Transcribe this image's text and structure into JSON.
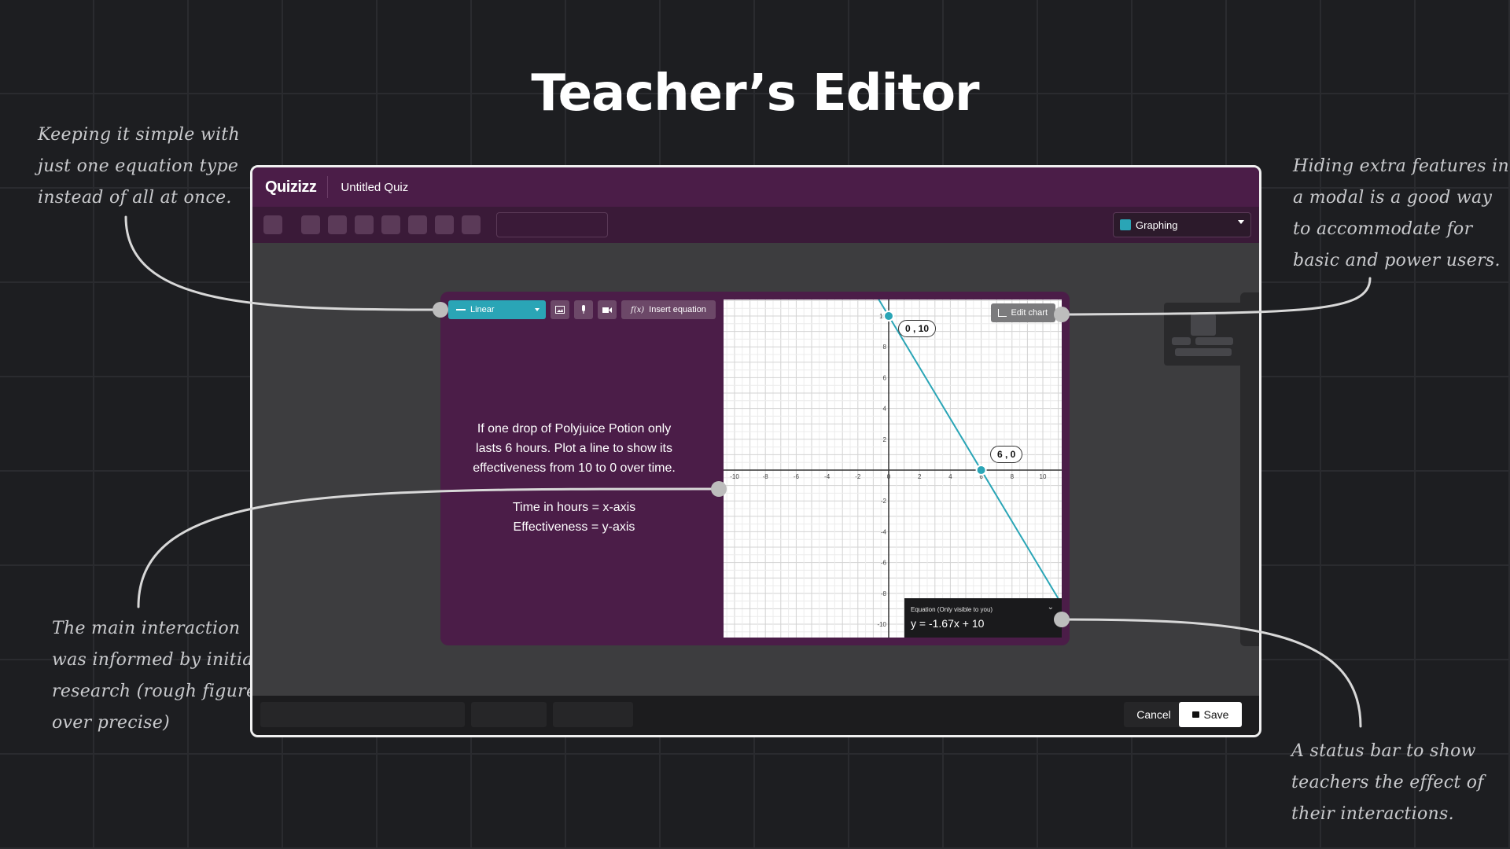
{
  "page": {
    "title": "Teacher’s Editor"
  },
  "annotations": {
    "simple_equation": [
      "Keeping it simple with",
      "just one equation type",
      "instead of all at once."
    ],
    "hidden_features": [
      "Hiding extra features in",
      "a modal is a good way",
      "to accommodate for",
      "basic and power users."
    ],
    "main_interaction": [
      "The main interaction",
      "was informed by initial",
      "research (rough figures",
      "over precise)"
    ],
    "status_bar": [
      "A status bar to show",
      "teachers the effect of",
      "their interactions."
    ]
  },
  "app": {
    "logo": "Quizizz",
    "quiz_title": "Untitled Quiz",
    "question_type": "Graphing",
    "equation_type": "Linear",
    "insert_equation_label": "Insert equation",
    "question_lines": [
      "If one drop of Polyjuice Potion only",
      "lasts 6 hours. Plot a line to show its",
      "effectiveness from 10 to 0 over time.",
      "Time in hours = x-axis",
      "Effectiveness = y-axis"
    ],
    "edit_chart_label": "Edit chart",
    "point_labels": [
      "0 , 10",
      "6 , 0"
    ],
    "equation_status_label": "Equation (Only visible to you)",
    "equation_value": "y = -1.67x + 10",
    "cancel_label": "Cancel",
    "save_label": "Save"
  },
  "colors": {
    "accent": "#2aa5b6",
    "header": "#4b1d48",
    "card": "#4b1d48"
  },
  "icons": [
    "image-icon",
    "microphone-icon",
    "video-icon",
    "chart-icon",
    "lock-icon",
    "chevron-down-icon"
  ],
  "chart_data": {
    "type": "line",
    "x_ticks": [
      "-10",
      "-8",
      "-6",
      "-4",
      "-2",
      "0",
      "2",
      "4",
      "6",
      "8",
      "10"
    ],
    "y_ticks": [
      "10",
      "8",
      "6",
      "4",
      "2",
      "-2",
      "-4",
      "-6",
      "-8",
      "-10"
    ],
    "xlim": [
      -10,
      10
    ],
    "ylim": [
      -10,
      10
    ],
    "points": [
      [
        0,
        10
      ],
      [
        6,
        0
      ]
    ],
    "grid": true
  }
}
